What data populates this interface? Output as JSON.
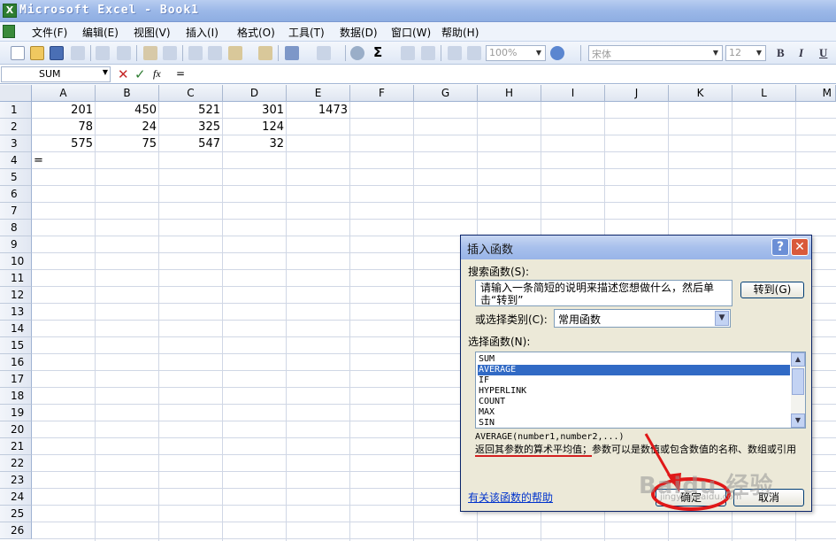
{
  "window": {
    "title": "Microsoft Excel - Book1"
  },
  "menu": [
    "文件(F)",
    "编辑(E)",
    "视图(V)",
    "插入(I)",
    "格式(O)",
    "工具(T)",
    "数据(D)",
    "窗口(W)",
    "帮助(H)"
  ],
  "toolbar": {
    "zoom": "100%",
    "font": "宋体",
    "font_size": "12",
    "bold": "B",
    "italic": "I",
    "underline": "U"
  },
  "formula_bar": {
    "name_box": "SUM",
    "cancel": "✕",
    "enter": "✓",
    "fx": "fx",
    "content": "="
  },
  "sheet": {
    "columns": [
      "A",
      "B",
      "C",
      "D",
      "E",
      "F",
      "G",
      "H",
      "I",
      "J",
      "K",
      "L",
      "M"
    ],
    "rows": [
      "1",
      "2",
      "3",
      "4",
      "5",
      "6",
      "7",
      "8",
      "9",
      "10",
      "11",
      "12",
      "13",
      "14",
      "15",
      "16",
      "17",
      "18",
      "19",
      "20",
      "21",
      "22",
      "23",
      "24",
      "25",
      "26"
    ],
    "cells": {
      "A1": "201",
      "B1": "450",
      "C1": "521",
      "D1": "301",
      "E1": "1473",
      "A2": "78",
      "B2": "24",
      "C2": "325",
      "D2": "124",
      "A3": "575",
      "B3": "75",
      "C3": "547",
      "D3": "32",
      "A4": "="
    }
  },
  "dialog": {
    "title": "插入函数",
    "help": "?",
    "close": "✕",
    "search_label": "搜索函数(S):",
    "search_text": "请输入一条简短的说明来描述您想做什么，然后单击“转到”",
    "go_button": "转到(G)",
    "category_label": "或选择类别(C):",
    "category_value": "常用函数",
    "select_label": "选择函数(N):",
    "functions": [
      "SUM",
      "AVERAGE",
      "IF",
      "HYPERLINK",
      "COUNT",
      "MAX",
      "SIN"
    ],
    "selected_function": "AVERAGE",
    "signature": "AVERAGE(number1,number2,...)",
    "description_highlight": "返回其参数的算术平均值；",
    "description_rest": "参数可以是数值或包含数值的名称、数组或引用",
    "help_link": "有关该函数的帮助",
    "ok_button": "确定",
    "cancel_button": "取消"
  },
  "watermark": {
    "brand": "Baidu 经验",
    "url": "jingyan.baidu.com"
  },
  "colors": {
    "selection": "#316ac5",
    "annotation": "#e01818",
    "link": "#0033cc"
  }
}
